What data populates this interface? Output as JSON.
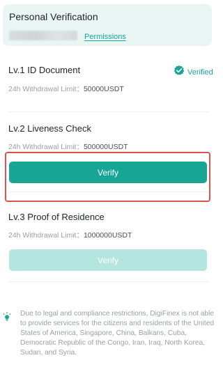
{
  "header": {
    "title": "Personal Verification",
    "permissions_link": "Permissions"
  },
  "levels": [
    {
      "title": "Lv.1 ID Document",
      "limit_label": "24h Withdrawal Limit：",
      "limit_value": "50000USDT",
      "status": "Verified"
    },
    {
      "title": "Lv.2 Liveness Check",
      "limit_label": "24h Withdrawal Limit：",
      "limit_value": "500000USDT",
      "button": "Verify"
    },
    {
      "title": "Lv.3 Proof of Residence",
      "limit_label": "24h Withdrawal Limit：",
      "limit_value": "1000000USDT",
      "button": "Verify"
    }
  ],
  "notice": {
    "text": "Due to legal and compliance restrictions, DigiFinex is not able to provide services for the citizens and residents of the United States of America, Singapore, China, Balkans, Cuba, Democratic Republic of the Congo, Iran, Iraq, North Korea, Sudan, and Syria."
  },
  "colors": {
    "accent": "#17a596",
    "accent_disabled": "#b4e5df",
    "header_bg": "#e9f6f4",
    "highlight": "#d9534f"
  },
  "icons": {
    "verified": "verified-badge-icon",
    "notice": "lightbulb-icon"
  }
}
